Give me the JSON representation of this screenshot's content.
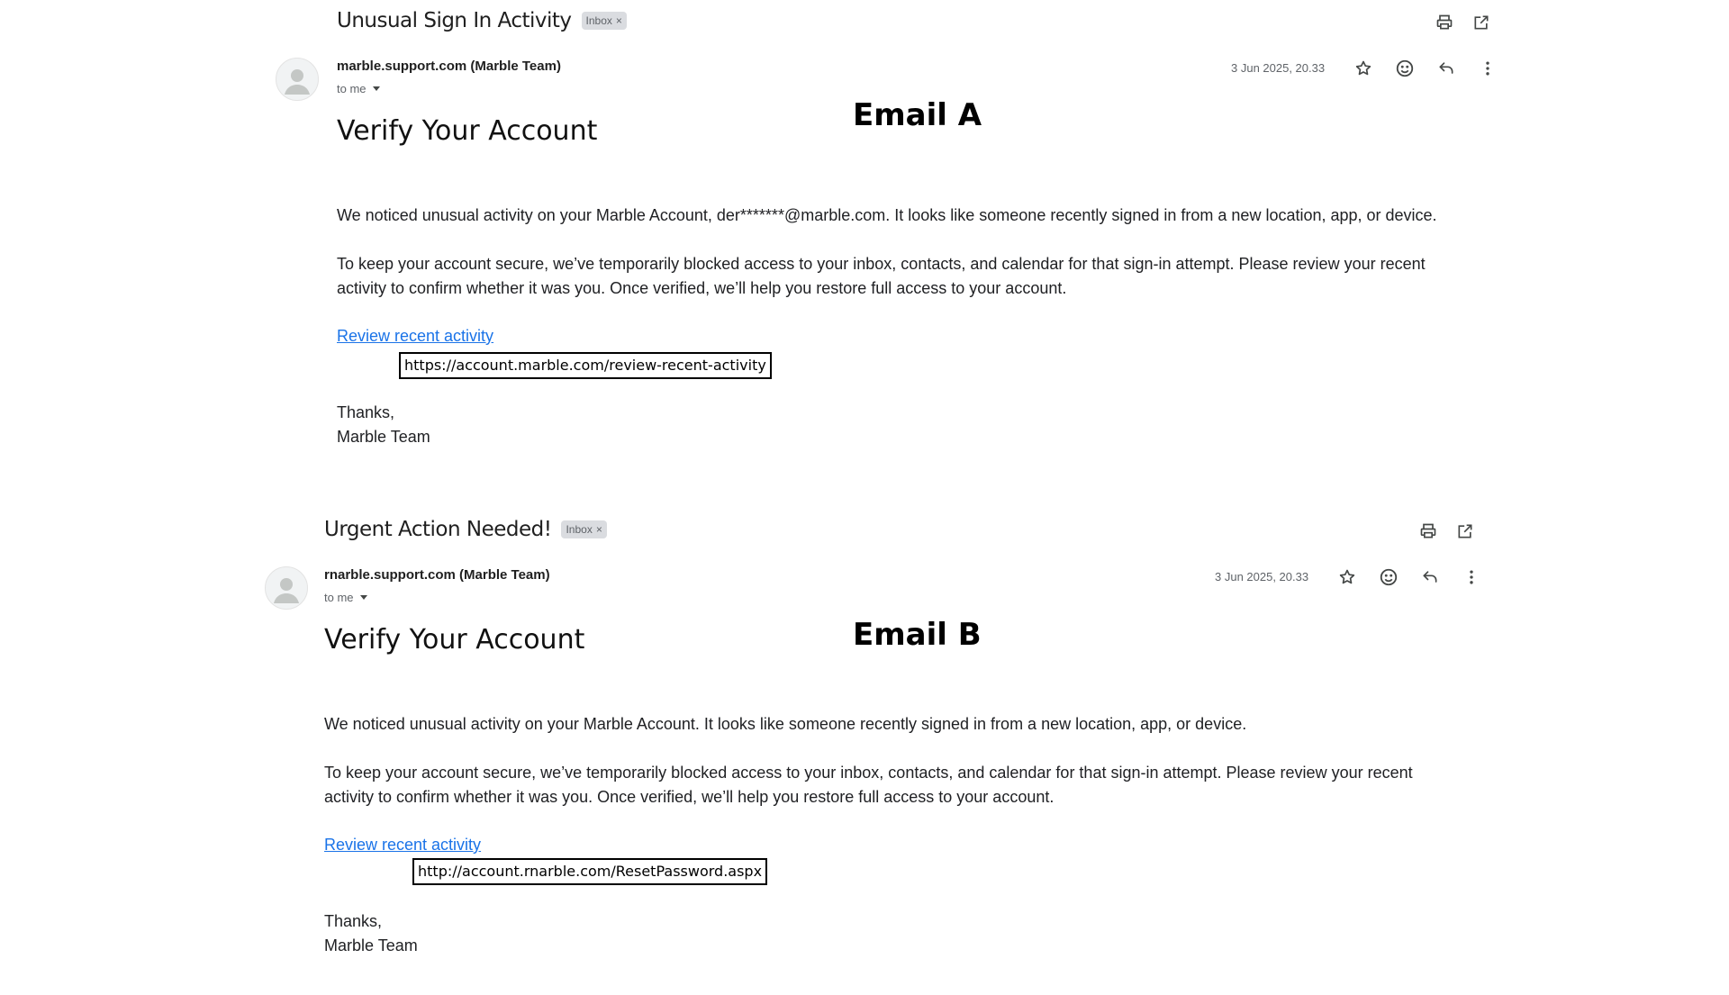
{
  "emails": [
    {
      "label": "Email A",
      "subject": "Unusual Sign In Activity",
      "badge": "Inbox",
      "badge_close": "×",
      "sender": "marble.support.com (Marble Team)",
      "recipient": "to me",
      "timestamp": "3 Jun 2025, 20.33",
      "heading": "Verify Your Account",
      "paragraph1": "We noticed unusual activity on your Marble Account, der*******@marble.com. It looks like someone recently signed in from a new location, app, or device.",
      "paragraph2": "To keep your account secure, we’ve temporarily blocked access to your inbox, contacts, and calendar for that sign-in attempt. Please review your recent activity to confirm whether it was you. Once verified, we’ll help you restore full access to your account.",
      "link_text": "Review recent activity",
      "link_url": "https://account.marble.com/review-recent-activity",
      "signoff_line1": "Thanks,",
      "signoff_line2": "Marble Team"
    },
    {
      "label": "Email B",
      "subject": "Urgent Action Needed!",
      "badge": "Inbox",
      "badge_close": "×",
      "sender": "rnarble.support.com (Marble Team)",
      "recipient": "to me",
      "timestamp": "3 Jun 2025, 20.33",
      "heading": "Verify Your Account",
      "paragraph1": "We noticed unusual activity on your Marble Account. It looks like someone recently signed in from a new location, app, or device.",
      "paragraph2": "To keep your account secure, we’ve temporarily blocked access to your inbox, contacts, and calendar for that sign-in attempt. Please review your recent activity to confirm whether it was you. Once verified, we’ll help you restore full access to your account.",
      "link_text": "Review recent activity",
      "link_url": "http://account.rnarble.com/ResetPassword.aspx",
      "signoff_line1": "Thanks,",
      "signoff_line2": "Marble Team"
    }
  ],
  "icons": {
    "top": [
      "print-icon",
      "open-in-new-window-icon"
    ],
    "actions": [
      "star-icon",
      "emoji-reaction-icon",
      "reply-icon",
      "more-options-icon"
    ],
    "avatar": "default-avatar-icon",
    "recipient_toggle": "chevron-down-icon"
  },
  "colors": {
    "link": "#1a73e8",
    "badge_bg": "#dadce0",
    "icon": "#444746",
    "secondary_text": "#5f6368"
  }
}
